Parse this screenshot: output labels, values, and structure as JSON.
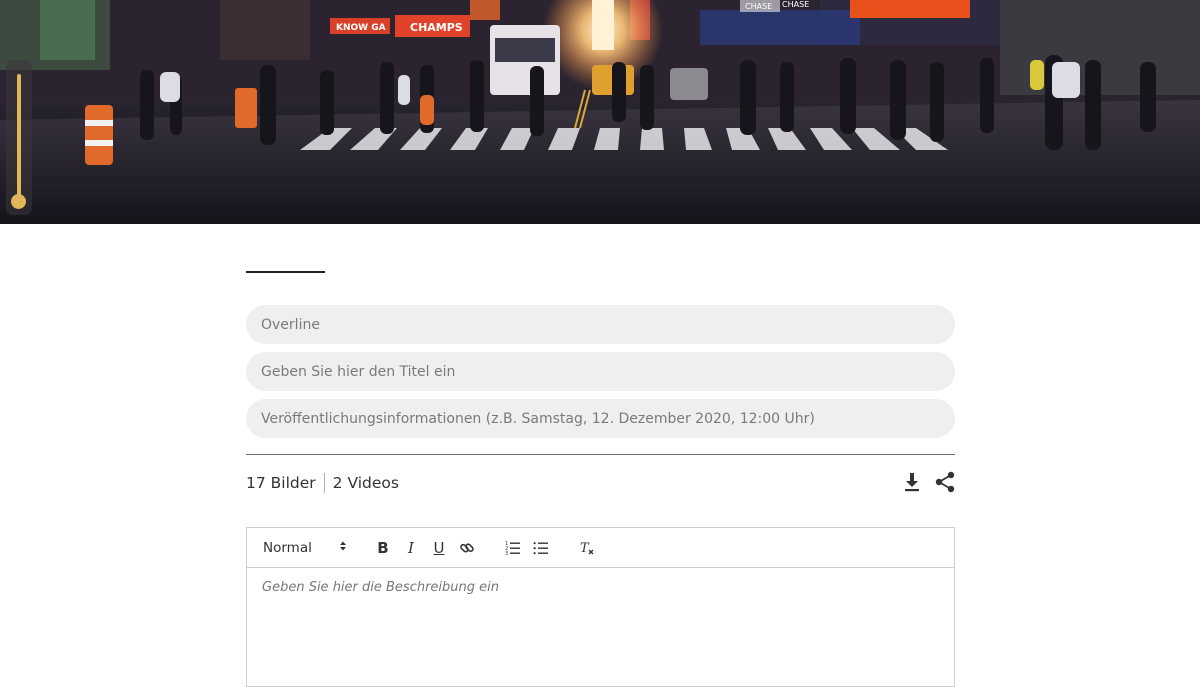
{
  "hero": {
    "image_label": "city-street-crosswalk-photo",
    "signs": [
      "KNOW GA",
      "CHAMPS",
      "CHASE",
      "CHASE"
    ]
  },
  "form": {
    "overline_placeholder": "Overline",
    "title_placeholder": "Geben Sie hier den Titel ein",
    "info_placeholder": "Veröffentlichungsinformationen (z.B. Samstag, 12. Dezember 2020, 12:00 Uhr)"
  },
  "media": {
    "images_label": "17 Bilder",
    "videos_label": "2 Videos"
  },
  "actions": {
    "download_icon": "download-icon",
    "share_icon": "share-icon"
  },
  "editor": {
    "format_value": "Normal",
    "description_placeholder": "Geben Sie hier die Beschreibung ein",
    "toolbar_icons": [
      "bold-icon",
      "italic-icon",
      "underline-icon",
      "link-icon",
      "ordered-list-icon",
      "bullet-list-icon",
      "clear-format-icon"
    ]
  },
  "colors": {
    "accent": "#e2b65a",
    "field_bg": "#efefef"
  }
}
